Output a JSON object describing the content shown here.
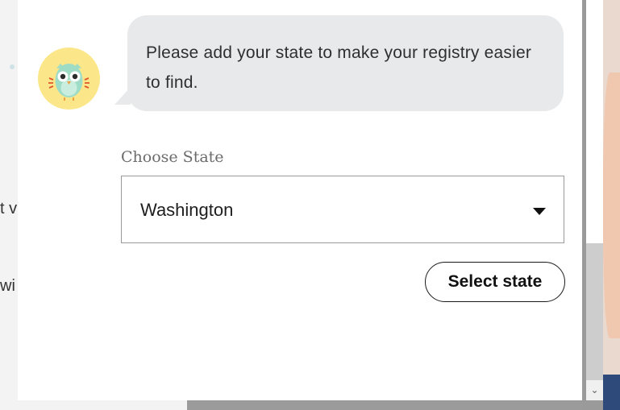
{
  "background": {
    "left_text_line1": "t v",
    "left_text_line2": "wi"
  },
  "chat": {
    "avatar_icon": "owl-icon",
    "message": "Please add your state to make your registry easier to find."
  },
  "state_field": {
    "label": "Choose State",
    "selected_value": "Washington",
    "dropdown_icon": "caret-down-icon"
  },
  "actions": {
    "select_state_label": "Select state"
  },
  "colors": {
    "avatar_bg": "#fbe78a",
    "bubble_bg": "#e8e9eb",
    "owl_body": "#9fdcc6"
  }
}
